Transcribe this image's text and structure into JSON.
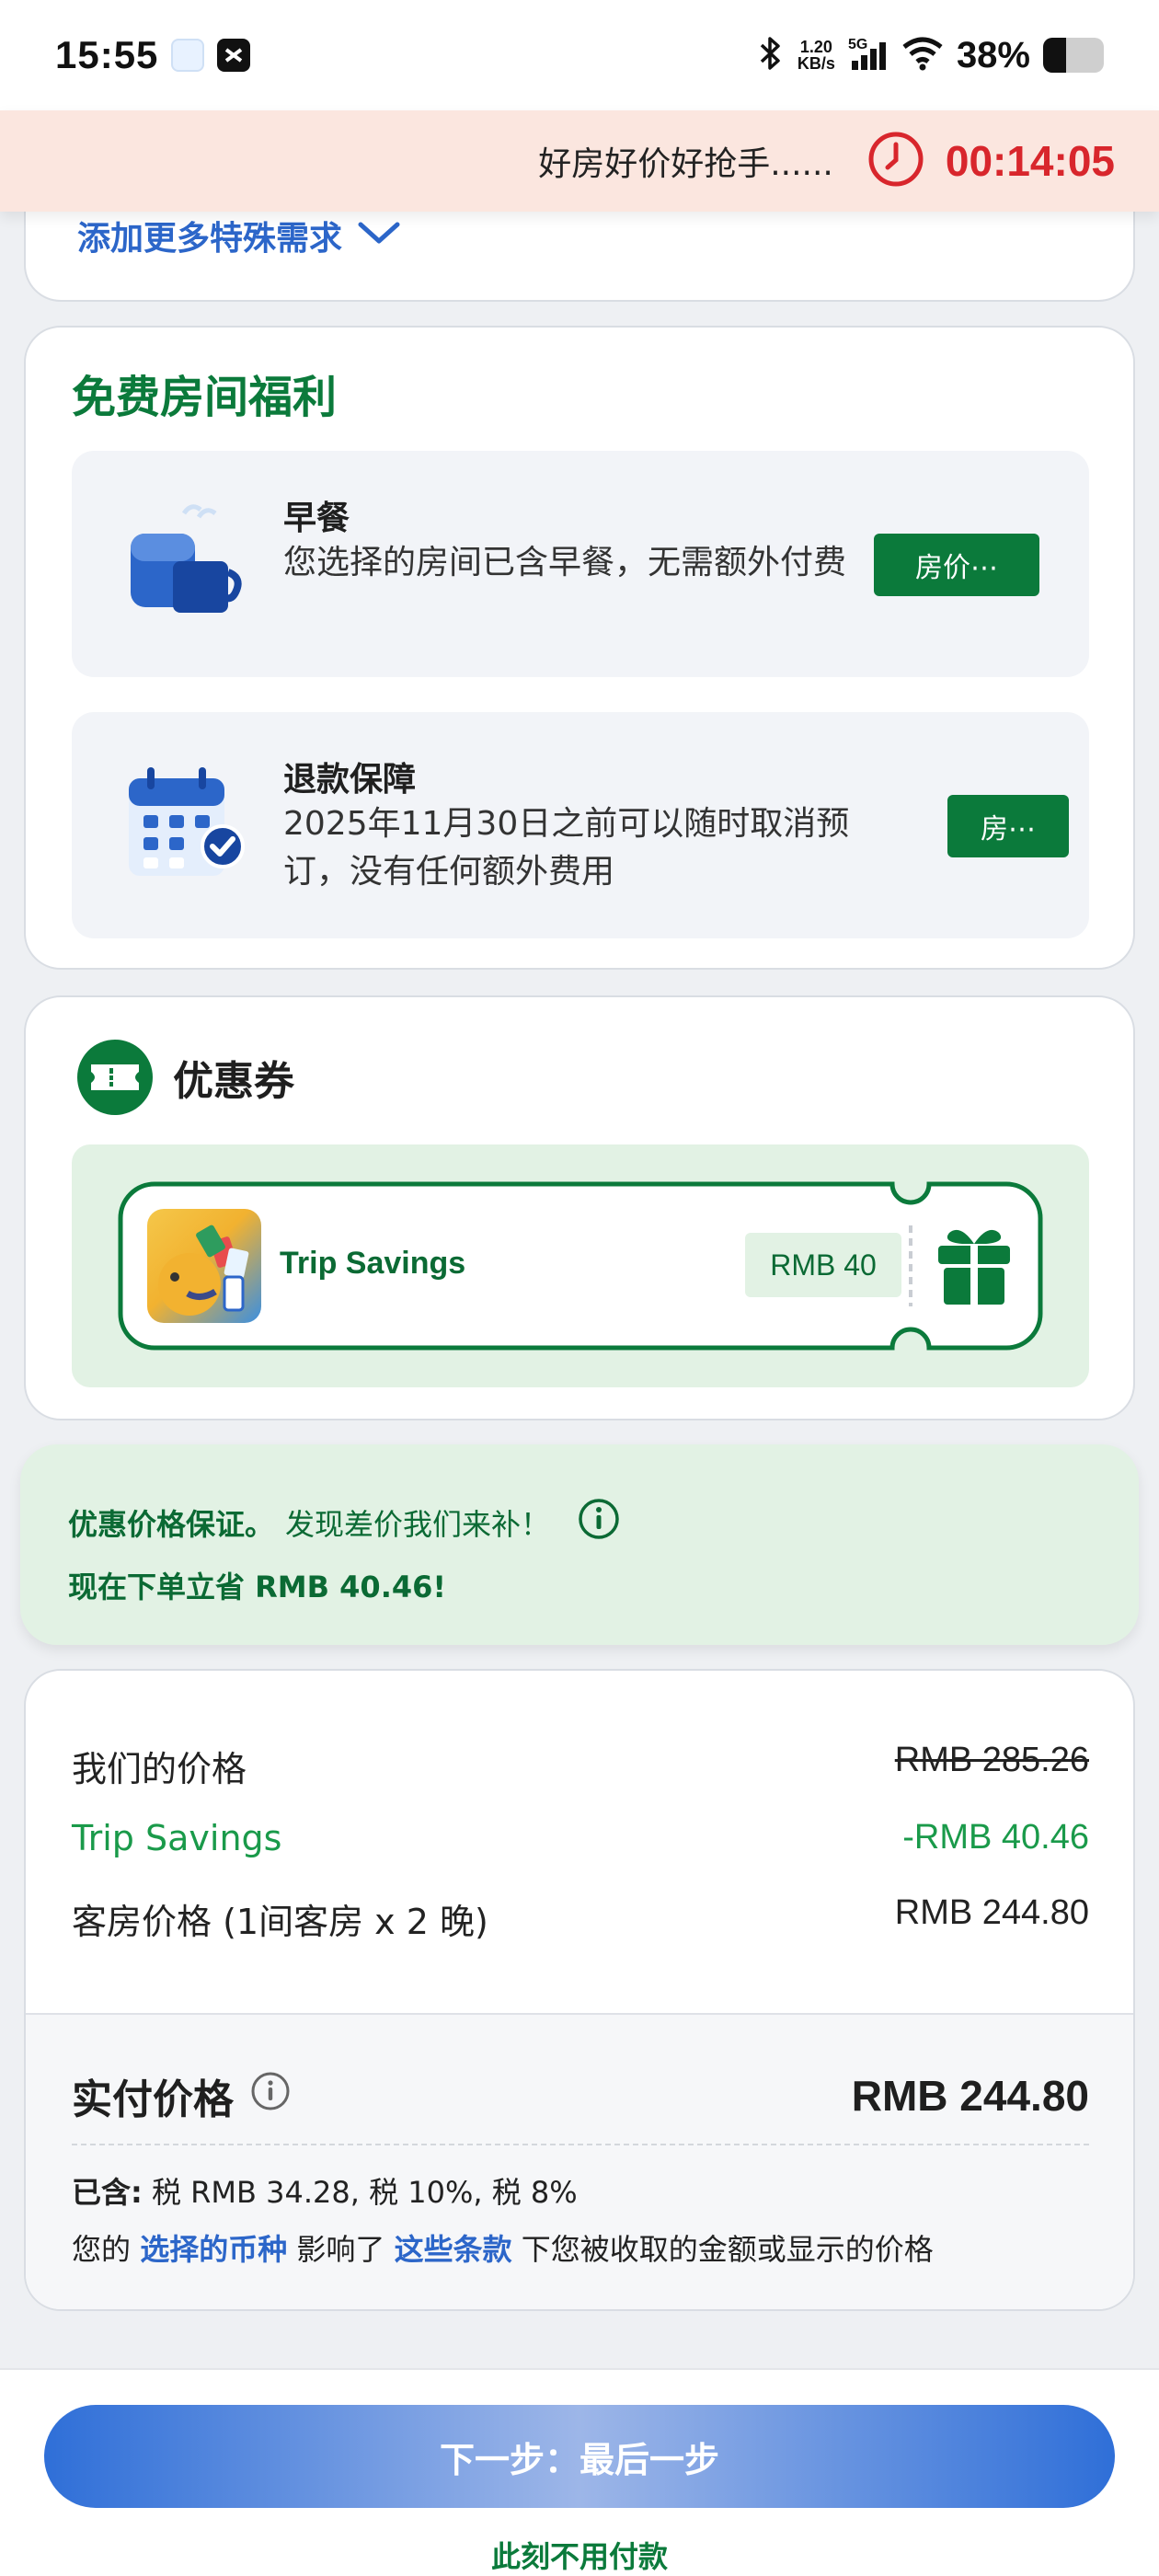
{
  "status_bar": {
    "time": "15:55",
    "net_speed_value": "1.20",
    "net_speed_unit": "KB/s",
    "network": "5G",
    "battery": "38%",
    "battery_level": 0.38
  },
  "timer": {
    "text": "好房好价好抢手......",
    "countdown": "00:14:05",
    "icon": "clock-icon"
  },
  "special_requests": {
    "more_label": "添加更多特殊需求"
  },
  "benefits": {
    "title": "免费房间福利",
    "items": [
      {
        "icon": "breakfast-icon",
        "title": "早餐",
        "desc": "您选择的房间已含早餐，无需额外付费",
        "button": "房价⋯"
      },
      {
        "icon": "calendar-check-icon",
        "title": "退款保障",
        "desc": "2025年11月30日之前可以随时取消预订，没有任何额外费用",
        "button": "房⋯"
      }
    ]
  },
  "coupon": {
    "title": "优惠券",
    "name": "Trip Savings",
    "amount": "RMB 40"
  },
  "guarantee": {
    "bold": "优惠价格保证。",
    "text": "发现差价我们来补！",
    "save": "现在下单立省 RMB 40.46!"
  },
  "price": {
    "rows": [
      {
        "label": "我们的价格",
        "value": "RMB 285.26"
      },
      {
        "label": "Trip Savings",
        "value": "-RMB 40.46"
      },
      {
        "label": "客房价格 (1间客房 x 2 晚)",
        "value": "RMB 244.80"
      }
    ],
    "total_label": "实付价格",
    "total_value": "RMB 244.80",
    "included_label": "已含:",
    "included_value": "税 RMB 34.28, 税 10%, 税 8%",
    "note_prefix": "您的",
    "note_link1": "选择的币种",
    "note_mid": "影响了",
    "note_link2": "这些条款",
    "note_suffix": "下您被收取的金额或显示的价格"
  },
  "footer": {
    "next_button": "下一步：最后一步",
    "pay_note": "此刻不用付款"
  },
  "colors": {
    "brand_green": "#0b7a3b",
    "link_blue": "#2c66c9",
    "alert_red": "#d8262c",
    "savings_green": "#1a9a4a"
  }
}
